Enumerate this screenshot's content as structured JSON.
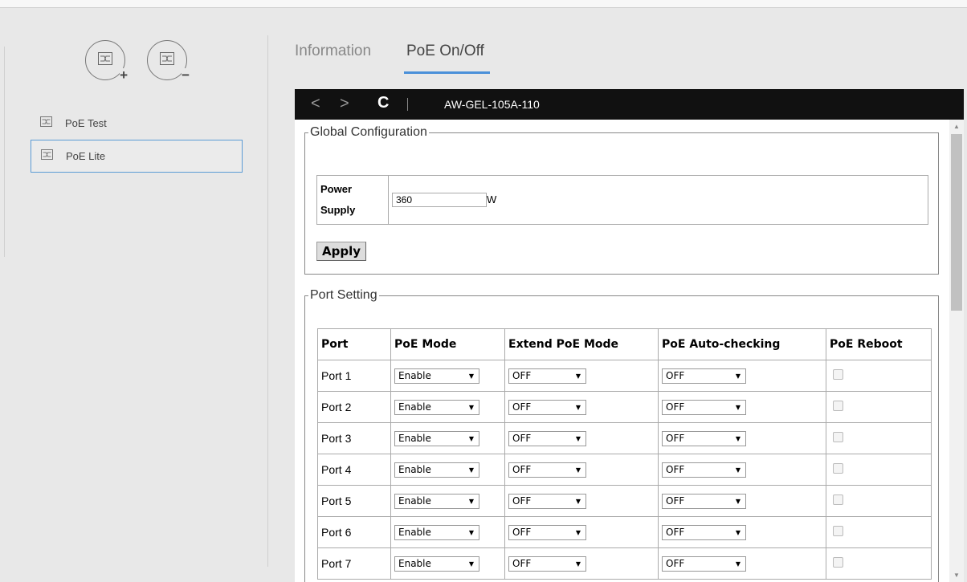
{
  "sidebar": {
    "add_device_badge": "+",
    "remove_device_badge": "−",
    "devices": [
      {
        "label": "PoE Test"
      },
      {
        "label": "PoE Lite"
      }
    ]
  },
  "tabs": [
    {
      "label": "Information"
    },
    {
      "label": "PoE On/Off"
    }
  ],
  "browser": {
    "url": "AW-GEL-105A-110",
    "back_glyph": "<",
    "forward_glyph": ">",
    "reload_glyph": "C"
  },
  "global_config": {
    "legend": "Global Configuration",
    "power_label_1": "Power",
    "power_label_2": "Supply",
    "power_value": "360",
    "unit": "W",
    "apply_label": "Apply"
  },
  "port_setting": {
    "legend": "Port Setting",
    "headers": [
      "Port",
      "PoE Mode",
      "Extend PoE Mode",
      "PoE Auto-checking",
      "PoE Reboot"
    ],
    "rows": [
      {
        "port": "Port 1",
        "poe_mode": "Enable",
        "extend": "OFF",
        "auto": "OFF"
      },
      {
        "port": "Port 2",
        "poe_mode": "Enable",
        "extend": "OFF",
        "auto": "OFF"
      },
      {
        "port": "Port 3",
        "poe_mode": "Enable",
        "extend": "OFF",
        "auto": "OFF"
      },
      {
        "port": "Port 4",
        "poe_mode": "Enable",
        "extend": "OFF",
        "auto": "OFF"
      },
      {
        "port": "Port 5",
        "poe_mode": "Enable",
        "extend": "OFF",
        "auto": "OFF"
      },
      {
        "port": "Port 6",
        "poe_mode": "Enable",
        "extend": "OFF",
        "auto": "OFF"
      },
      {
        "port": "Port 7",
        "poe_mode": "Enable",
        "extend": "OFF",
        "auto": "OFF"
      }
    ]
  },
  "colors": {
    "accent": "#4a90d9",
    "selection_border": "#5b9bd5",
    "browser_bar": "#111111"
  }
}
